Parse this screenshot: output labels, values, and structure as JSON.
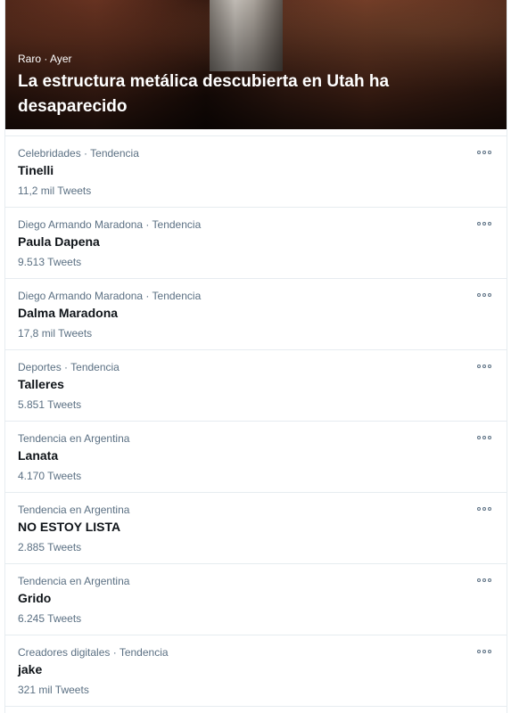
{
  "featured": {
    "category": "Raro",
    "time": "Ayer",
    "separator": "·",
    "headline": "La estructura metálica descubierta en Utah ha desaparecido"
  },
  "trends": [
    {
      "context": "Celebridades · Tendencia",
      "name": "Tinelli",
      "count": "11,2 mil Tweets"
    },
    {
      "context": "Diego Armando Maradona · Tendencia",
      "name": "Paula Dapena",
      "count": "9.513 Tweets"
    },
    {
      "context": "Diego Armando Maradona · Tendencia",
      "name": "Dalma Maradona",
      "count": "17,8 mil Tweets"
    },
    {
      "context": "Deportes · Tendencia",
      "name": "Talleres",
      "count": "5.851 Tweets"
    },
    {
      "context": "Tendencia en Argentina",
      "name": "Lanata",
      "count": "4.170 Tweets"
    },
    {
      "context": "Tendencia en Argentina",
      "name": "NO ESTOY LISTA",
      "count": "2.885 Tweets"
    },
    {
      "context": "Tendencia en Argentina",
      "name": "Grido",
      "count": "6.245 Tweets"
    },
    {
      "context": "Creadores digitales · Tendencia",
      "name": "jake",
      "count": "321 mil Tweets"
    }
  ],
  "icons": {
    "more": "more-horizontal-icon"
  }
}
